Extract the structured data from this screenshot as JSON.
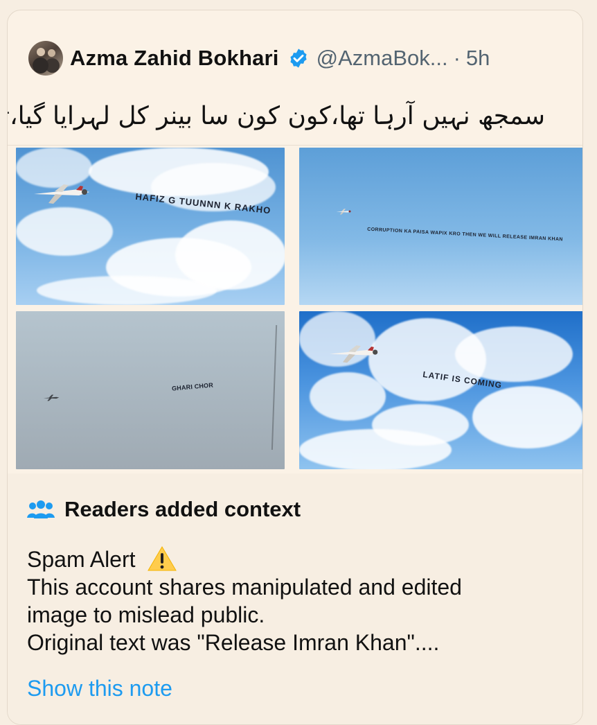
{
  "tweet": {
    "author_name": "Azma Zahid Bokhari",
    "handle": "@AzmaBok...",
    "separator": "·",
    "time": "5h",
    "text": "سمجھ نہیں آرہا تھا،کون کون سا بینر کل لہرایا گیا،تو سوچا پوچھ لوں",
    "icons": {
      "avatar": "author-avatar",
      "verified": "verified-badge-icon"
    }
  },
  "images": [
    {
      "banner_text": "HAFIZ G TUUNNN K RAKHO",
      "scene": "blue sky with clouds and small plane"
    },
    {
      "banner_text": "CORRUPTION KA PAISA WAPIX KRO THEN WE WILL RELEASE IMRAN KHAN",
      "scene": "blue sky with small plane"
    },
    {
      "banner_text": "GHARI CHOR",
      "scene": "grey sky with small plane"
    },
    {
      "banner_text": "LATIF IS COMING",
      "scene": "blue sky with clouds and small plane"
    }
  ],
  "community_note": {
    "title": "Readers added context",
    "line1": "Spam Alert",
    "line2": "This account shares manipulated and edited",
    "line3": "image to mislead public.",
    "line4": "Original text was \"Release Imran Khan\"....",
    "link_text": "Show this note",
    "icons": {
      "people": "people-icon",
      "warning": "warning-icon"
    }
  },
  "colors": {
    "background": "#f7eee2",
    "card": "#fbf2e6",
    "link": "#1d9bf0",
    "verified": "#1d9bf0"
  }
}
